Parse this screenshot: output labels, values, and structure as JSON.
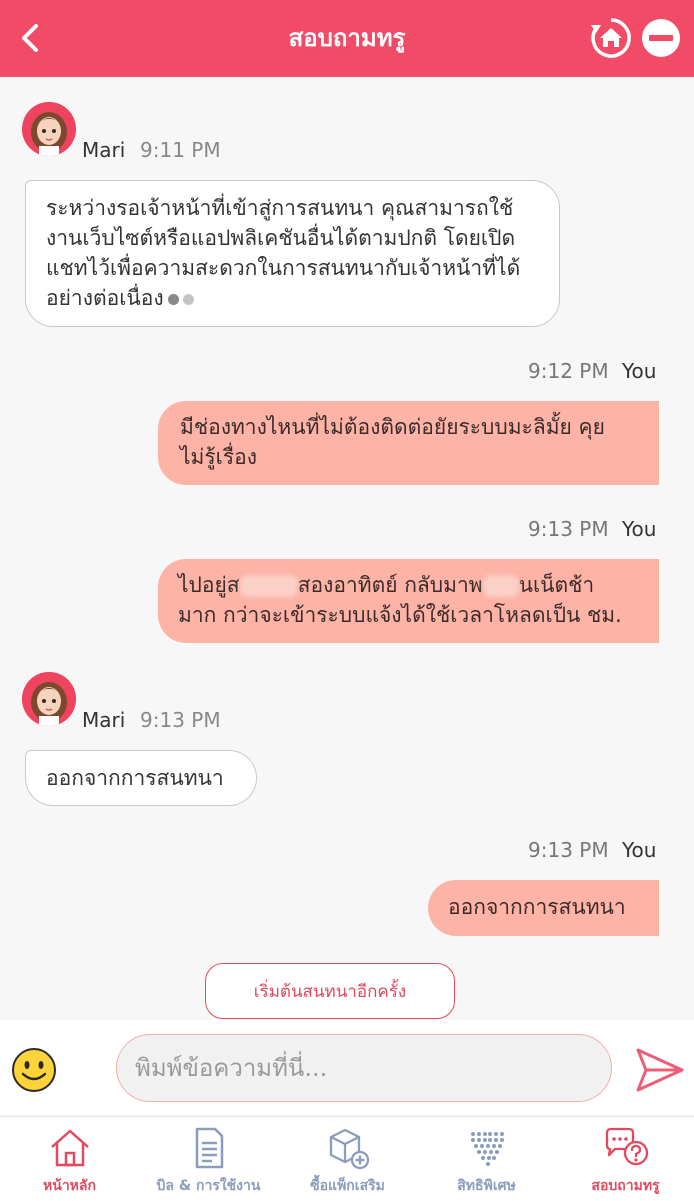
{
  "header": {
    "title": "สอบถามทรู"
  },
  "messages": [
    {
      "sender": "Mari",
      "time": "9:11 PM",
      "lines": [
        "ระหว่างรอเจ้าหน้าที่เข้าสู่การสนทนา คุณสามารถใช้",
        "งานเว็บไซต์หรือแอปพลิเคชันอื่นได้ตามปกติ โดยเปิด",
        "แชทไว้เพื่อความสะดวกในการสนทนากับเจ้าหน้าที่ได้",
        "อย่างต่อเนื่อง"
      ]
    },
    {
      "sender": "You",
      "time": "9:12 PM",
      "lines": [
        "มีช่องทางไหนที่ไม่ต้องติดต่อยัยระบบมะลิมั้ย คุย",
        "ไม่รู้เรื่อง"
      ]
    },
    {
      "sender": "You",
      "time": "9:13 PM",
      "line1_a": "ไปอยู่ส",
      "line1_b": "สองอาทิตย์ กลับมาพ",
      "line1_c": "นเน็ตช้า",
      "line2": "มาก กว่าจะเข้าระบบแจ้งได้ใช้เวลาโหลดเป็น ชม."
    },
    {
      "sender": "Mari",
      "time": "9:13 PM",
      "text": "ออกจากการสนทนา"
    },
    {
      "sender": "You",
      "time": "9:13 PM",
      "text": "ออกจากการสนทนา"
    }
  ],
  "restart_label": "เริ่มต้นสนทนาอีกครั้ง",
  "composer": {
    "placeholder": "พิมพ์ข้อความที่นี่..."
  },
  "tabs": [
    {
      "label": "หน้าหลัก",
      "icon": "home-icon",
      "active": true
    },
    {
      "label": "บิล & การใช้งาน",
      "icon": "bill-document-icon",
      "active": false
    },
    {
      "label": "ซื้อแพ็กเสริม",
      "icon": "package-add-icon",
      "active": false
    },
    {
      "label": "สิทธิพิเศษ",
      "icon": "heart-dots-icon",
      "active": false
    },
    {
      "label": "สอบถามทรู",
      "icon": "chat-question-icon",
      "active": true
    }
  ],
  "colors": {
    "brand": "#f24b67",
    "my_bubble": "#fdb3a6",
    "tab_inactive": "#8b9dbb"
  }
}
